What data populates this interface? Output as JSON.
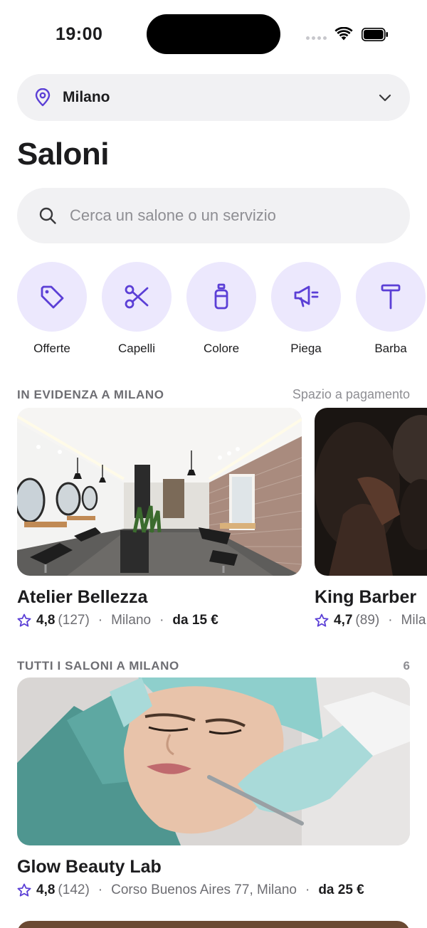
{
  "status": {
    "time": "19:00"
  },
  "location": {
    "city": "Milano"
  },
  "page_title": "Saloni",
  "search": {
    "placeholder": "Cerca un salone o un servizio"
  },
  "categories": [
    {
      "label": "Offerte",
      "icon": "tag-icon"
    },
    {
      "label": "Capelli",
      "icon": "scissors-icon"
    },
    {
      "label": "Colore",
      "icon": "bottle-icon"
    },
    {
      "label": "Piega",
      "icon": "hairdryer-icon"
    },
    {
      "label": "Barba",
      "icon": "razor-icon"
    }
  ],
  "featured": {
    "heading": "IN EVIDENZA A MILANO",
    "sponsored_label": "Spazio a pagamento",
    "items": [
      {
        "name": "Atelier Bellezza",
        "rating": "4,8",
        "reviews": "(127)",
        "city": "Milano",
        "price": "da 15 €"
      },
      {
        "name": "King Barber",
        "rating": "4,7",
        "reviews": "(89)",
        "city": "Mila"
      }
    ]
  },
  "all": {
    "heading": "TUTTI I SALONI A MILANO",
    "count": "6",
    "items": [
      {
        "name": "Glow Beauty Lab",
        "rating": "4,8",
        "reviews": "(142)",
        "address": "Corso Buenos Aires 77, Milano",
        "price": "da 25 €"
      }
    ]
  },
  "colors": {
    "accent": "#5b3fd6",
    "accent_soft": "#ece8fd",
    "pill_bg": "#f1f1f3"
  },
  "separator": "·"
}
